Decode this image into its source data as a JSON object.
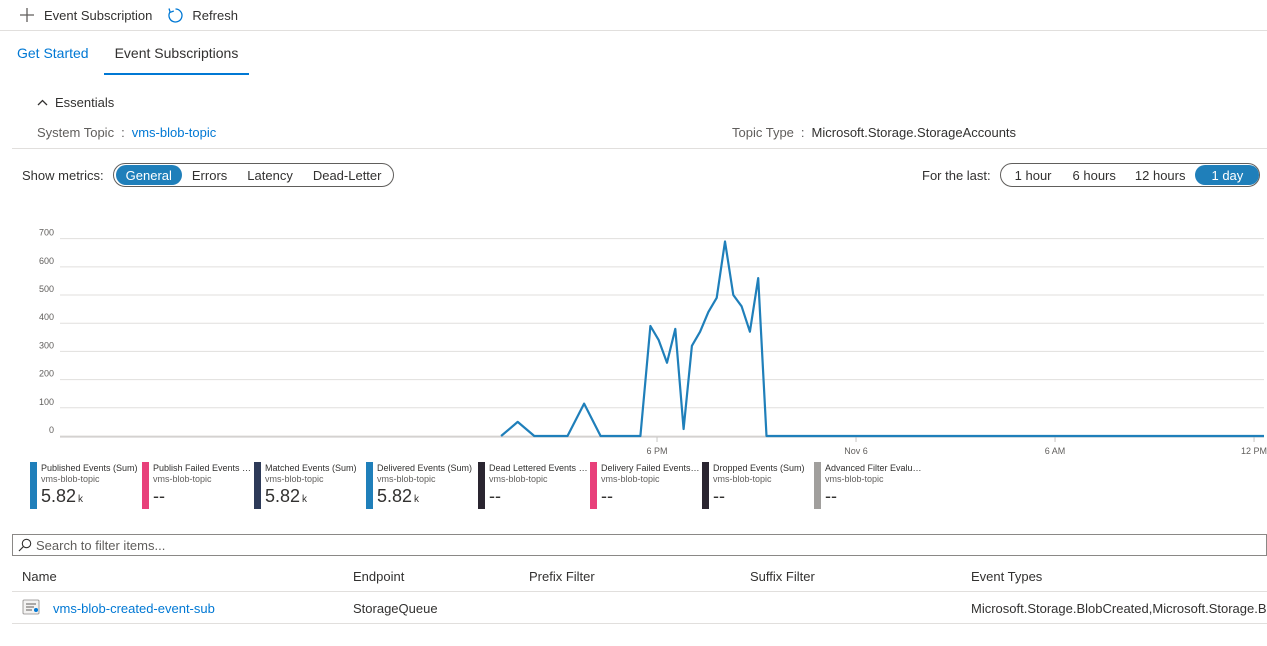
{
  "toolbar": {
    "event_subscription_label": "Event Subscription",
    "refresh_label": "Refresh"
  },
  "tabs": [
    {
      "label": "Get Started",
      "active": false
    },
    {
      "label": "Event Subscriptions",
      "active": true
    }
  ],
  "essentials": {
    "toggle_label": "Essentials",
    "system_topic_label": "System Topic",
    "system_topic_value": "vms-blob-topic",
    "topic_type_label": "Topic Type",
    "topic_type_value": "Microsoft.Storage.StorageAccounts",
    "separator": ":"
  },
  "metrics": {
    "show_label": "Show metrics:",
    "options": [
      "General",
      "Errors",
      "Latency",
      "Dead-Letter"
    ],
    "selected": "General"
  },
  "timerange": {
    "label": "For the last:",
    "options": [
      "1 hour",
      "6 hours",
      "12 hours",
      "1 day"
    ],
    "selected": "1 day"
  },
  "colors": {
    "accent": "#0078d4",
    "series_line": "#1f7fba",
    "grid": "#e1dfdd"
  },
  "chart_data": {
    "type": "line",
    "y_ticks": [
      "0",
      "100",
      "200",
      "300",
      "400",
      "500",
      "600",
      "700"
    ],
    "ylim": [
      0,
      720
    ],
    "x_ticks": [
      {
        "label": "6 PM",
        "x": 18
      },
      {
        "label": "Nov 6",
        "x": 24
      },
      {
        "label": "6 AM",
        "x": 30
      },
      {
        "label": "12 PM",
        "x": 36
      }
    ],
    "xlim": [
      0,
      36.3
    ],
    "grid": true,
    "series": [
      {
        "name": "Published Events (Sum)",
        "points": [
          [
            13.3,
            0
          ],
          [
            13.8,
            50
          ],
          [
            14.3,
            0
          ],
          [
            15.3,
            0
          ],
          [
            15.8,
            115
          ],
          [
            16.3,
            0
          ],
          [
            17.3,
            0
          ],
          [
            17.5,
            0
          ],
          [
            17.8,
            390
          ],
          [
            18.05,
            340
          ],
          [
            18.3,
            260
          ],
          [
            18.55,
            380
          ],
          [
            18.8,
            25
          ],
          [
            19.05,
            320
          ],
          [
            19.3,
            370
          ],
          [
            19.55,
            440
          ],
          [
            19.8,
            490
          ],
          [
            20.05,
            690
          ],
          [
            20.3,
            500
          ],
          [
            20.55,
            460
          ],
          [
            20.8,
            370
          ],
          [
            21.05,
            560
          ],
          [
            21.3,
            0
          ],
          [
            36.3,
            0
          ]
        ]
      }
    ]
  },
  "legend": [
    {
      "name": "Published Events (Sum)",
      "resource": "vms-blob-topic",
      "value": "5.82",
      "unit": "k",
      "color": "#1f7fba"
    },
    {
      "name": "Publish Failed Events (Sum)",
      "resource": "vms-blob-topic",
      "value": "--",
      "unit": "",
      "color": "#e8407a"
    },
    {
      "name": "Matched Events (Sum)",
      "resource": "vms-blob-topic",
      "value": "5.82",
      "unit": "k",
      "color": "#2d3a58"
    },
    {
      "name": "Delivered Events (Sum)",
      "resource": "vms-blob-topic",
      "value": "5.82",
      "unit": "k",
      "color": "#1f7fba"
    },
    {
      "name": "Dead Lettered Events (Sum)",
      "resource": "vms-blob-topic",
      "value": "--",
      "unit": "",
      "color": "#2a2530"
    },
    {
      "name": "Delivery Failed Events (Sum)",
      "resource": "vms-blob-topic",
      "value": "--",
      "unit": "",
      "color": "#e8407a"
    },
    {
      "name": "Dropped Events (Sum)",
      "resource": "vms-blob-topic",
      "value": "--",
      "unit": "",
      "color": "#2a2530"
    },
    {
      "name": "Advanced Filter Evaluations (Sum)",
      "resource": "vms-blob-topic",
      "value": "--",
      "unit": "",
      "color": "#a19f9d"
    }
  ],
  "search": {
    "placeholder": "Search to filter items..."
  },
  "table": {
    "columns": [
      "Name",
      "Endpoint",
      "Prefix Filter",
      "Suffix Filter",
      "Event Types"
    ],
    "rows": [
      {
        "name": "vms-blob-created-event-sub",
        "endpoint": "StorageQueue",
        "prefix": "",
        "suffix": "",
        "event_types": "Microsoft.Storage.BlobCreated,Microsoft.Storage.BlobDeleted"
      }
    ]
  }
}
